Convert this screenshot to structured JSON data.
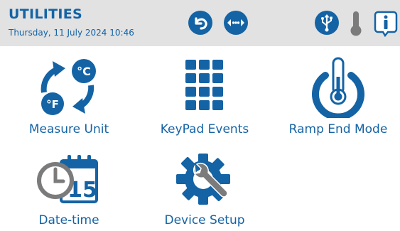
{
  "header": {
    "title": "UTILITIES",
    "datetime": "Thursday, 11 July 2024 10:46"
  },
  "header_buttons": [
    {
      "name": "back-icon"
    },
    {
      "name": "connection-icon"
    },
    {
      "name": "usb-icon"
    },
    {
      "name": "thermometer-icon"
    },
    {
      "name": "info-icon"
    }
  ],
  "tiles": {
    "measure_unit": {
      "label": "Measure Unit",
      "icon": "celsius-fahrenheit-icon"
    },
    "keypad_events": {
      "label": "KeyPad Events",
      "icon": "keypad-icon"
    },
    "ramp_end_mode": {
      "label": "Ramp End Mode",
      "icon": "thermometer-power-icon"
    },
    "date_time": {
      "label": "Date-time",
      "icon": "clock-calendar-icon",
      "calendar_day": "15"
    },
    "device_setup": {
      "label": "Device Setup",
      "icon": "gear-wrench-icon"
    }
  },
  "colors": {
    "primary": "#1463a5",
    "header_bg": "#e2e2e2",
    "grey_icon": "#7b7b7b"
  }
}
